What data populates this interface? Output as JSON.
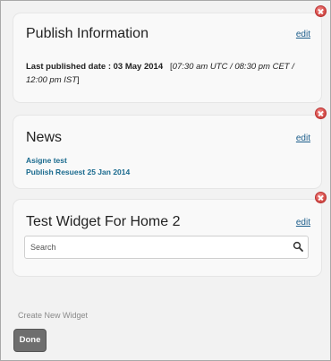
{
  "widgets": {
    "publish": {
      "title": "Publish Information",
      "edit_label": "edit",
      "label": "Last published date : 03 May 2014",
      "bracket_open": "[",
      "times": "07:30 am UTC / 08:30 pm CET / 12:00 pm IST",
      "bracket_close": "]"
    },
    "news": {
      "title": "News",
      "edit_label": "edit",
      "items": [
        "Asigne test",
        "Publish Resuest 25 Jan 2014"
      ]
    },
    "test": {
      "title": "Test Widget For Home 2",
      "edit_label": "edit",
      "search": {
        "placeholder": "Search",
        "icon": "search-icon"
      }
    }
  },
  "footer": {
    "create_label": "Create New Widget",
    "done_label": "Done"
  },
  "colors": {
    "link": "#1a5c8a",
    "news_link": "#1a6a8e",
    "close": "#d9534f",
    "done_bg": "#6e6e6e"
  }
}
